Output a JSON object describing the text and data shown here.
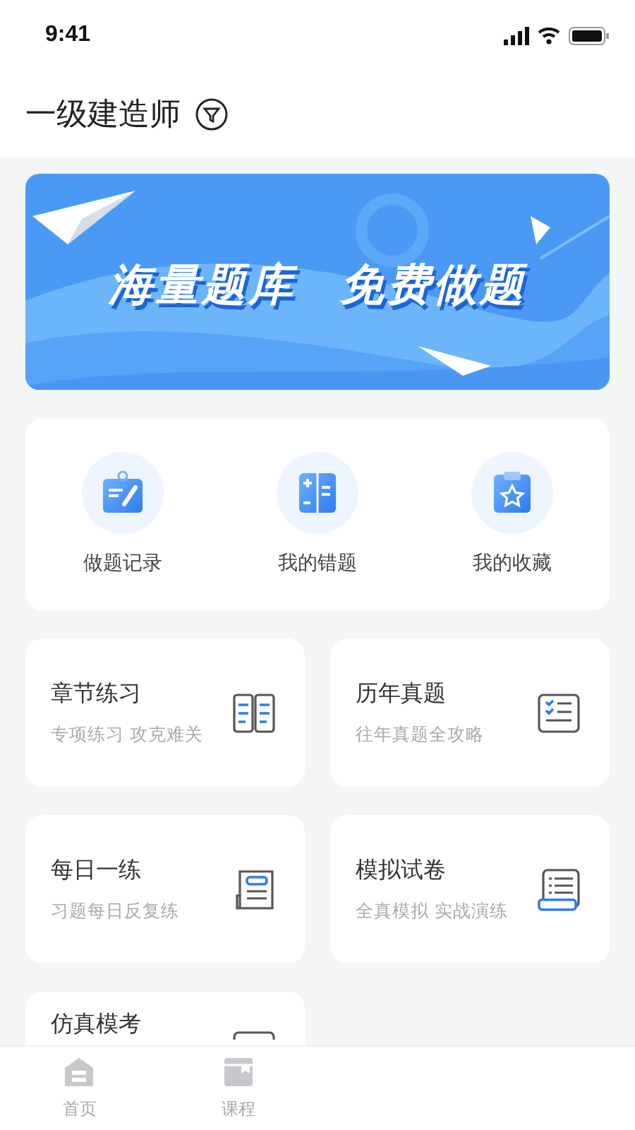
{
  "status_bar": {
    "time": "9:41"
  },
  "header": {
    "title": "一级建造师"
  },
  "banner": {
    "texts": [
      "海量题库",
      "免费做题"
    ]
  },
  "shortcuts": [
    {
      "kind": "record",
      "label": "做题记录"
    },
    {
      "kind": "mistakes",
      "label": "我的错题"
    },
    {
      "kind": "favorites",
      "label": "我的收藏"
    }
  ],
  "modules": [
    {
      "kind": "book",
      "title": "章节练习",
      "subtitle": "专项练习 攻克难关"
    },
    {
      "kind": "checklist",
      "title": "历年真题",
      "subtitle": "往年真题全攻略"
    },
    {
      "kind": "newspaper",
      "title": "每日一练",
      "subtitle": "习题每日反复练"
    },
    {
      "kind": "scroll",
      "title": "模拟试卷",
      "subtitle": "全真模拟 实战演练"
    },
    {
      "kind": "exam",
      "title": "仿真模考"
    }
  ],
  "tab_bar": [
    {
      "kind": "home",
      "label": "首页",
      "selected": false
    },
    {
      "kind": "course",
      "label": "课程",
      "selected": false
    }
  ]
}
